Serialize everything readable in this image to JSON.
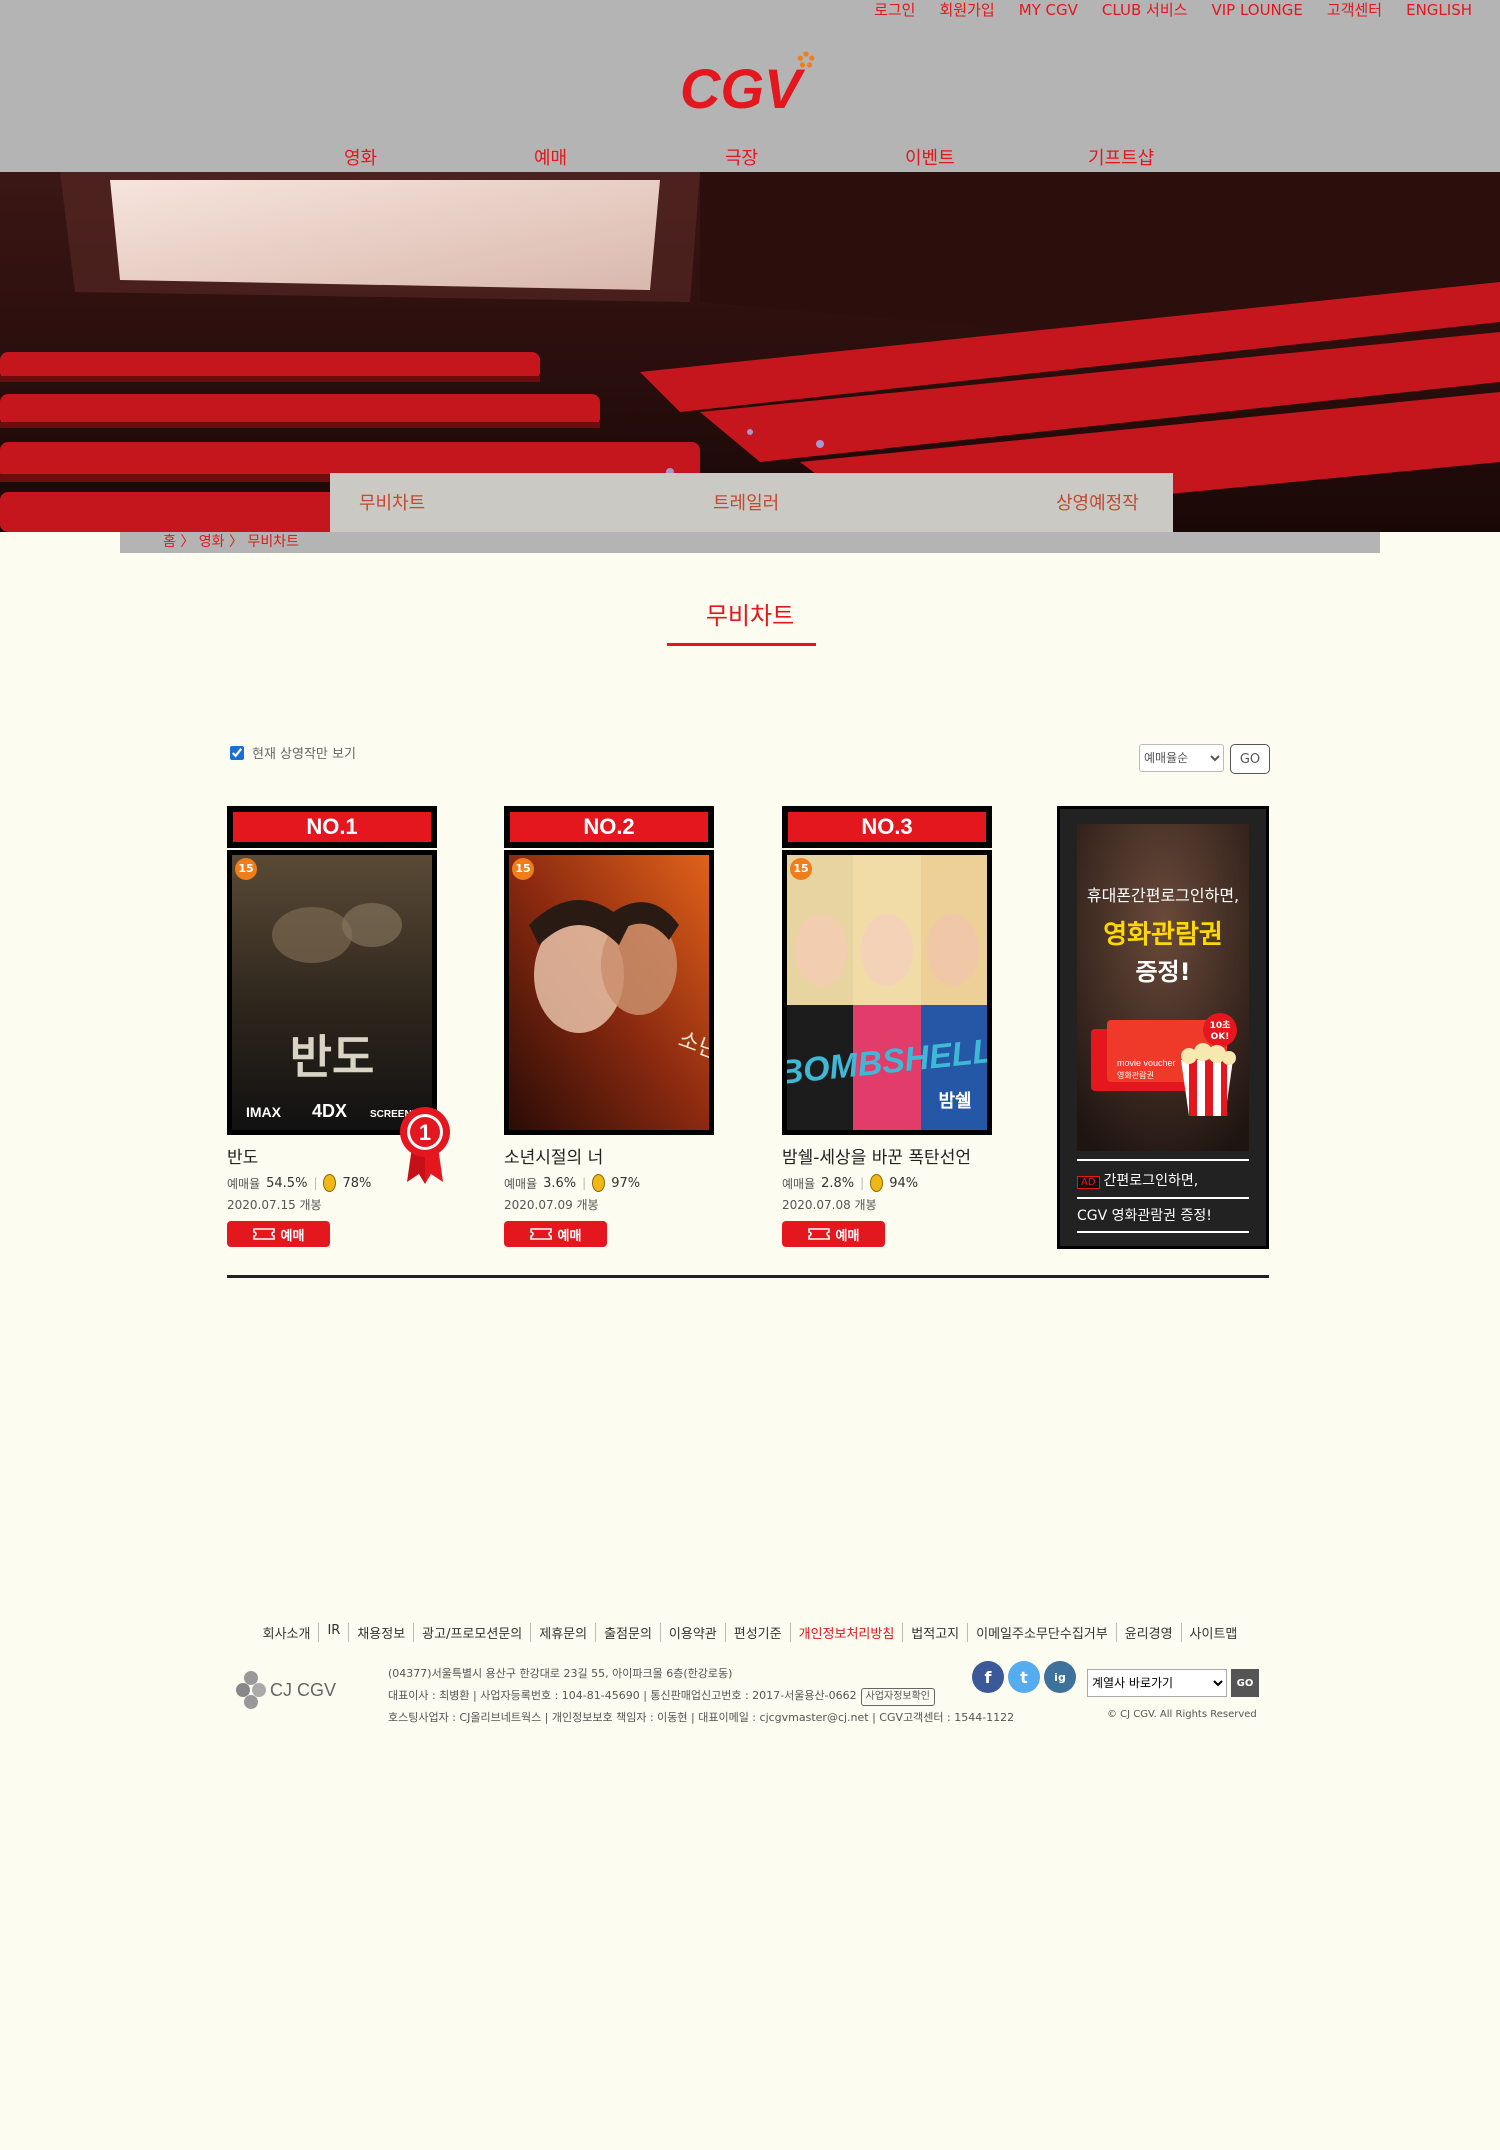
{
  "header": {
    "util_nav": [
      "로그인",
      "회원가입",
      "MY CGV",
      "CLUB 서비스",
      "VIP LOUNGE",
      "고객센터",
      "ENGLISH"
    ],
    "logo": "CGV",
    "gnb": [
      "영화",
      "예매",
      "극장",
      "이벤트",
      "기프트샵"
    ]
  },
  "sub_tabs": [
    "무비차트",
    "트레일러",
    "상영예정작"
  ],
  "breadcrumb": [
    "홈",
    "영화",
    "무비차트"
  ],
  "page_title": "무비차트",
  "filter": {
    "label": "현재 상영작만 보기",
    "checked": true
  },
  "sort": {
    "selected": "예매율순",
    "go": "GO"
  },
  "movies": [
    {
      "rank": "NO.1",
      "age": "15",
      "title": "반도",
      "rate_label": "예매율",
      "rate": "54.5%",
      "egg": "78%",
      "date": "2020.07.15 개봉",
      "book": "예매",
      "poster_title": "반도",
      "poster_badges": [
        "IMAX",
        "4DX",
        "SCREENX"
      ],
      "medal": "1"
    },
    {
      "rank": "NO.2",
      "age": "15",
      "title": "소년시절의 너",
      "rate_label": "예매율",
      "rate": "3.6%",
      "egg": "97%",
      "date": "2020.07.09 개봉",
      "book": "예매"
    },
    {
      "rank": "NO.3",
      "age": "15",
      "title": "밤쉘-세상을 바꾼 폭탄선언",
      "rate_label": "예매율",
      "rate": "2.8%",
      "egg": "94%",
      "date": "2020.07.08 개봉",
      "book": "예매",
      "poster_title": "BOMBSHELL",
      "poster_sub": "밤쉘"
    }
  ],
  "ad": {
    "line1": "휴대폰간편로그인하면,",
    "line2": "영화관람권",
    "line3": "증정!",
    "badge": "10초 OK!",
    "voucher": "movie voucher",
    "voucher_sub": "영화관람권",
    "tag": "AD",
    "caption1": "간편로그인하면,",
    "caption2": "CGV 영화관람권 증정!"
  },
  "footer": {
    "links": [
      "회사소개",
      "IR",
      "채용정보",
      "광고/프로모션문의",
      "제휴문의",
      "출점문의",
      "이용약관",
      "편성기준",
      "개인정보처리방침",
      "법적고지",
      "이메일주소무단수집거부",
      "윤리경영",
      "사이트맵"
    ],
    "highlight": "개인정보처리방침",
    "logo": "CJ CGV",
    "address": "(04377)서울특별시 용산구 한강대로 23길 55, 아이파크몰 6층(한강로동)",
    "ceo_line": "대표이사 : 최병환 | 사업자등록번호 : 104-81-45690 | 통신판매업신고번호 : 2017-서울용산-0662",
    "biz_check": "사업자정보확인",
    "host_line": "호스팅사업자 : CJ올리브네트웍스 | 개인정보보호 책임자 : 이동현 | 대표이메일 : cjcgvmaster@cj.net | CGV고객센터 : 1544-1122",
    "sns": [
      "f",
      "t",
      "ig"
    ],
    "affiliate": "계열사 바로가기",
    "affiliate_go": "GO",
    "copyright": "© CJ CGV. All Rights Reserved"
  }
}
